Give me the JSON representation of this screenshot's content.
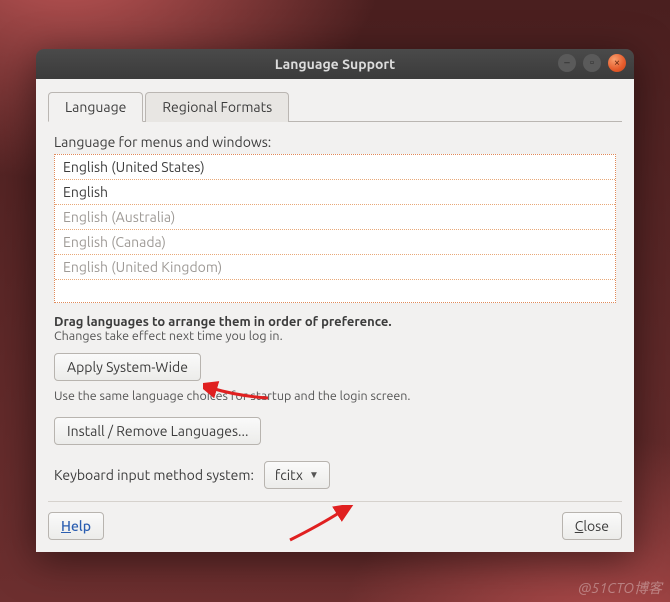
{
  "window": {
    "title": "Language Support"
  },
  "tabs": {
    "language": "Language",
    "regional": "Regional Formats"
  },
  "section": {
    "label": "Language for menus and windows:",
    "hint_bold": "Drag languages to arrange them in order of preference.",
    "hint_sub": "Changes take effect next time you log in.",
    "apply_btn": "Apply System-Wide",
    "apply_desc": "Use the same language choices for startup and the login screen.",
    "install_btn": "Install / Remove Languages...",
    "kbd_label": "Keyboard input method system:",
    "kbd_value": "fcitx"
  },
  "lang_list": {
    "0": "English (United States)",
    "1": "English",
    "2": "English (Australia)",
    "3": "English (Canada)",
    "4": "English (United Kingdom)"
  },
  "footer": {
    "help_u": "H",
    "help_rest": "elp",
    "close_u": "C",
    "close_rest": "lose"
  },
  "watermark": "@51CTO博客"
}
